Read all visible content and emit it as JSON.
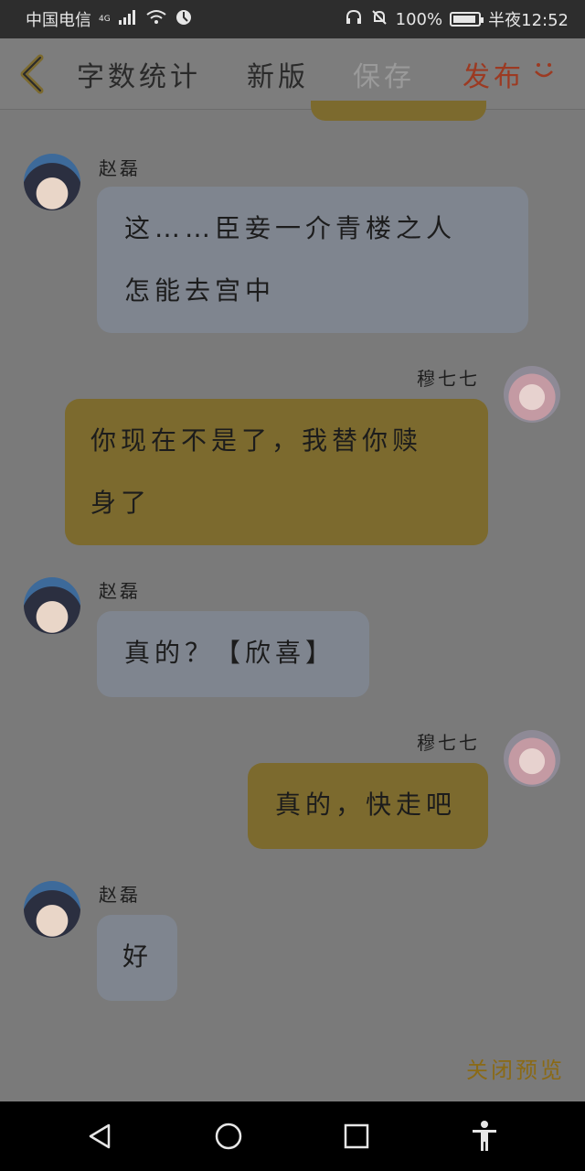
{
  "status_bar": {
    "carrier": "中国电信",
    "network": "4G",
    "battery": "100%",
    "time": "半夜12:52"
  },
  "toolbar": {
    "word_count": "字数统计",
    "new_version": "新版",
    "save": "保存",
    "publish": "发布"
  },
  "messages": [
    {
      "side": "left",
      "name": "赵磊",
      "lines": [
        "这……臣妾一介青楼之人",
        "怎能去宫中"
      ]
    },
    {
      "side": "right",
      "name": "穆七七",
      "lines": [
        "你现在不是了，我替你赎",
        "身了"
      ]
    },
    {
      "side": "left",
      "name": "赵磊",
      "lines": [
        "真的？【欣喜】"
      ]
    },
    {
      "side": "right",
      "name": "穆七七",
      "lines": [
        "真的，快走吧"
      ]
    },
    {
      "side": "left",
      "name": "赵磊",
      "lines": [
        "好"
      ]
    }
  ],
  "footer": {
    "close_preview": "关闭预览"
  },
  "colors": {
    "overlay_bg": "#7a7a7a",
    "left_bubble": "#7f858f",
    "right_bubble": "#7c6a2e",
    "publish_text": "#9c3a22",
    "close_preview_text": "#8a6a16"
  }
}
